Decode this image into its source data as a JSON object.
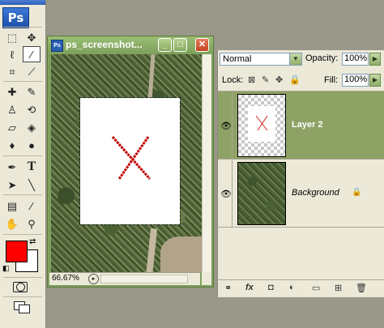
{
  "app": {
    "logo": "Ps"
  },
  "tools": {
    "foreground_color": "#ff0000",
    "background_color": "#ffffff",
    "items": [
      "marquee-icon",
      "move-icon",
      "lasso-icon",
      "magic-wand-icon",
      "crop-icon",
      "slice-icon",
      "healing-brush-icon",
      "brush-icon",
      "clone-stamp-icon",
      "history-brush-icon",
      "eraser-icon",
      "paint-bucket-icon",
      "blur-icon",
      "dodge-icon",
      "pen-icon",
      "type-icon",
      "path-selection-icon",
      "line-icon",
      "notes-icon",
      "eyedropper-icon",
      "hand-icon",
      "zoom-icon"
    ]
  },
  "document": {
    "title": "ps_screenshot...",
    "zoom": "66.67%",
    "window_color": "#7ea15c"
  },
  "layers_panel": {
    "blend_mode": "Normal",
    "opacity_label": "Opacity:",
    "opacity_value": "100%",
    "lock_label": "Lock:",
    "fill_label": "Fill:",
    "fill_value": "100%",
    "selected_color": "#8fa266",
    "layers": [
      {
        "name": "Layer 2",
        "selected": true
      },
      {
        "name": "Background",
        "selected": false,
        "locked": true
      }
    ]
  }
}
